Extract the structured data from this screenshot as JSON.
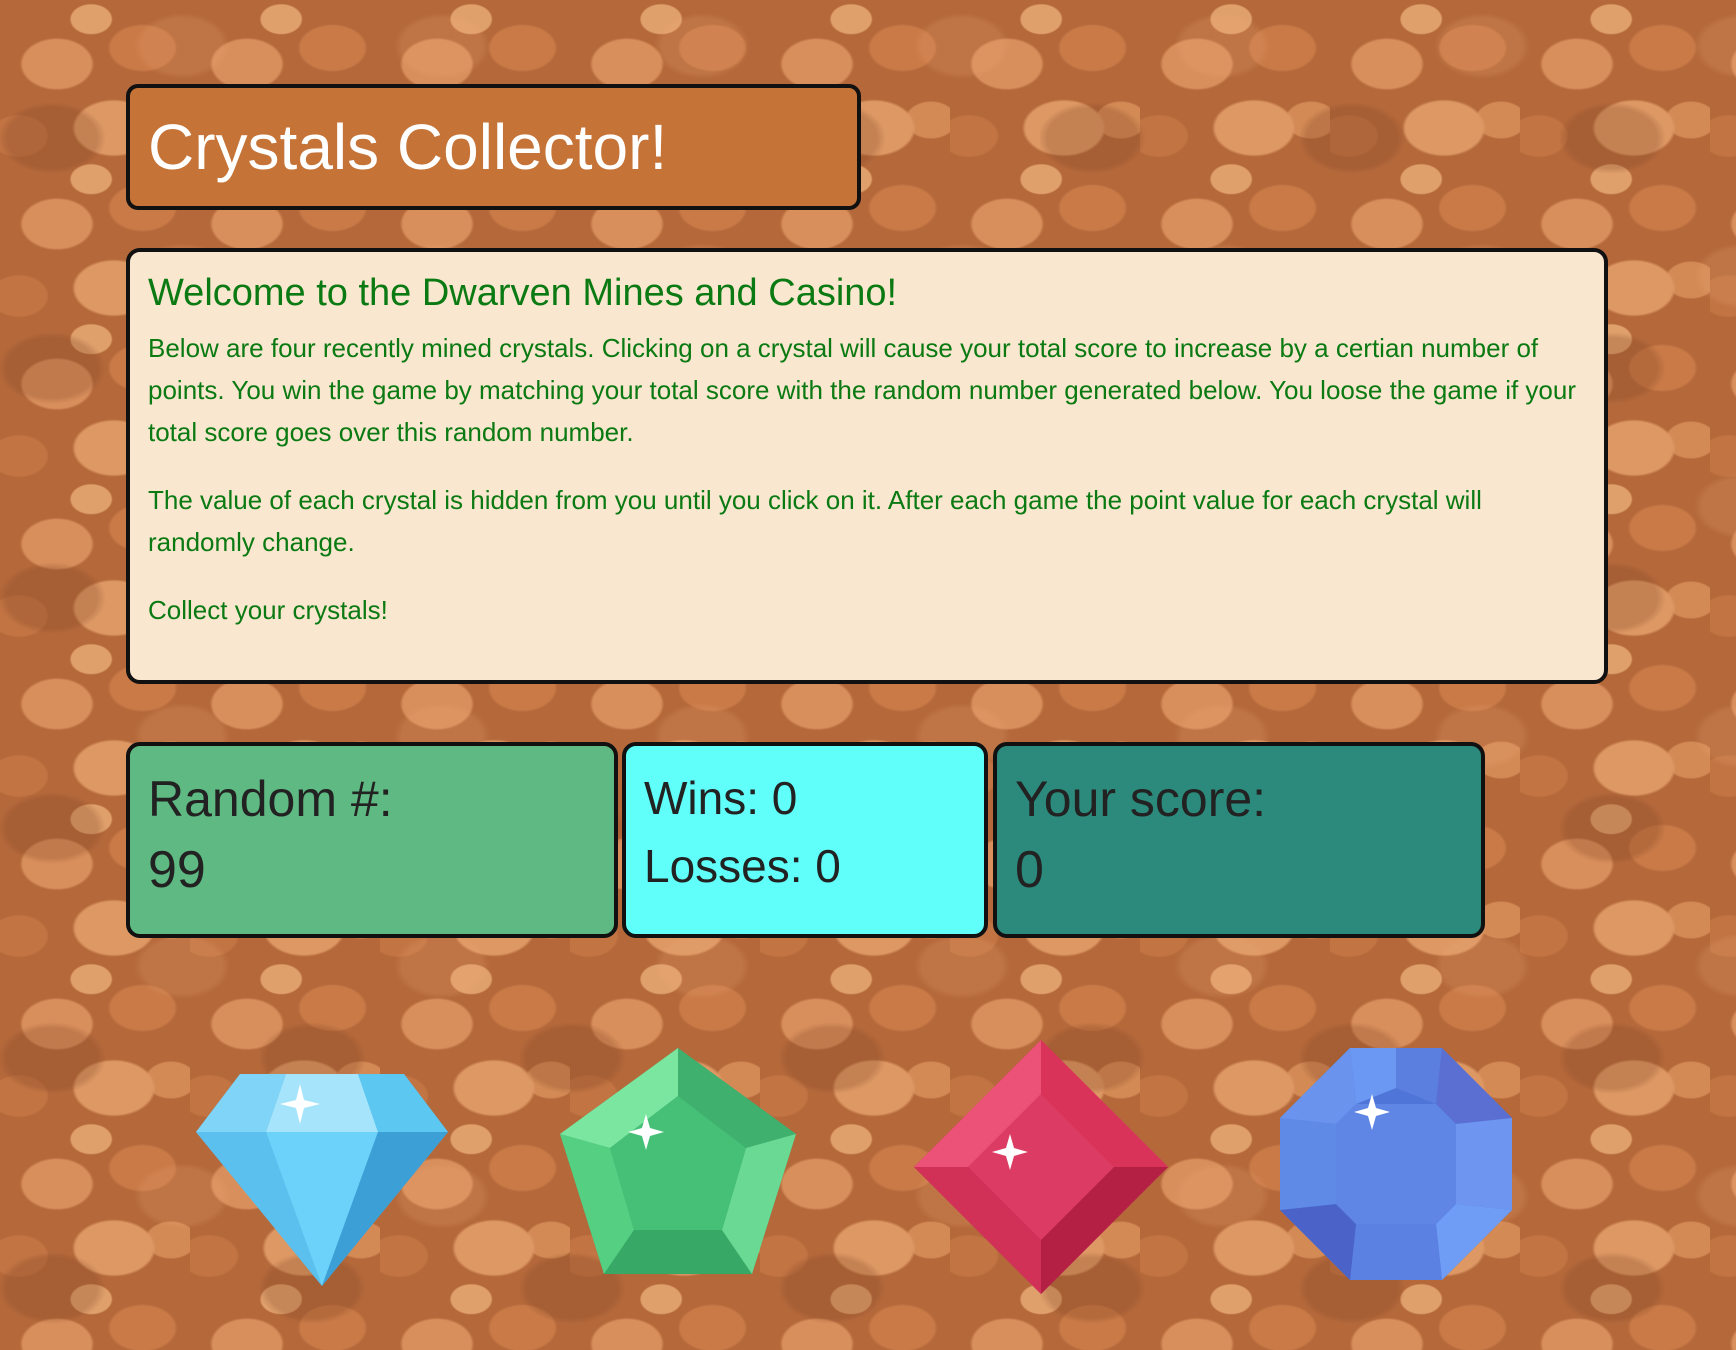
{
  "header": {
    "title": "Crystals Collector!"
  },
  "intro": {
    "heading": "Welcome to the Dwarven Mines and Casino!",
    "paragraph_1": "Below are four recently mined crystals. Clicking on a crystal will cause your total score to increase by a certian number of points. You win the game by matching your total score with the random number generated below. You loose the game if your total score goes over this random number.",
    "paragraph_2": "The value of each crystal is hidden from you until you click on it. After each game the point value for each crystal will randomly change.",
    "paragraph_3": "Collect your crystals!"
  },
  "stats": {
    "random_label": "Random #:",
    "random_value": "99",
    "wins_text": "Wins: 0",
    "losses_text": "Losses: 0",
    "score_label": "Your score:",
    "score_value": "0"
  },
  "crystals": [
    {
      "name": "diamond-crystal",
      "color": "#5cc7f0"
    },
    {
      "name": "emerald-crystal",
      "color": "#4cc97a"
    },
    {
      "name": "ruby-crystal",
      "color": "#e03d64"
    },
    {
      "name": "sapphire-crystal",
      "color": "#5b86e6"
    }
  ],
  "colors": {
    "title_bg": "#c57336",
    "intro_bg": "#f9e7d0",
    "intro_text": "#0b7a12",
    "random_bg": "#5fb982",
    "wins_bg": "#60fff9",
    "score_bg": "#2c8a7d"
  }
}
